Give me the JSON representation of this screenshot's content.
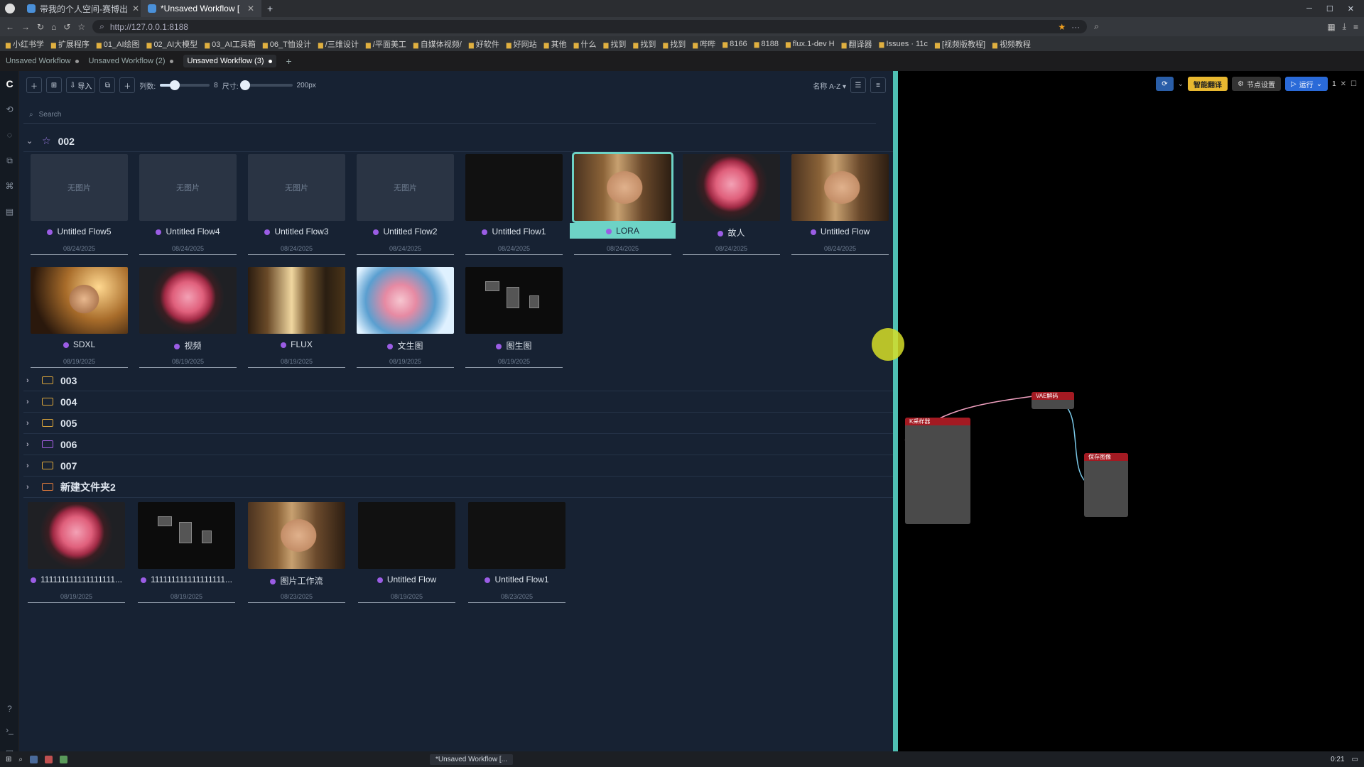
{
  "browser": {
    "tabs": [
      {
        "label": "带我的个人空间-赛博出",
        "active": false
      },
      {
        "label": "*Unsaved Workflow [",
        "active": true
      }
    ],
    "url": "http://127.0.0.1:8188",
    "bookmarks": [
      "小红书学",
      "扩展程序",
      "01_AI绘图",
      "02_AI大模型",
      "03_AI工具箱",
      "06_T恤设计",
      "/三维设计",
      "/平面美工",
      "自媒体视频/",
      "好软件",
      "好网站",
      "其他",
      "什么",
      "找到",
      "找到",
      "找到",
      "哔哔",
      "8166",
      "8188",
      "flux.1-dev H",
      "翻译器",
      "Issues · 11c",
      "[视频版教程]",
      "视频教程"
    ]
  },
  "workflow_tabs": [
    {
      "label": "Unsaved Workflow",
      "active": false
    },
    {
      "label": "Unsaved Workflow (2)",
      "active": false
    },
    {
      "label": "Unsaved Workflow (3)",
      "active": true
    }
  ],
  "toolbar": {
    "import_label": "导入",
    "cols_label": "列数:",
    "cols_value": "8",
    "size_label": "尺寸:",
    "size_value": "200px",
    "sort_label": "名称 A-Z",
    "cols_fraction": 0.3,
    "size_fraction": 0.05
  },
  "search": {
    "placeholder": "Search"
  },
  "groups": {
    "g002": {
      "name": "002",
      "row1": [
        {
          "name": "Untitled Flow5",
          "date": "08/24/2025",
          "thumb": "empty",
          "empty_text": "无图片"
        },
        {
          "name": "Untitled Flow4",
          "date": "08/24/2025",
          "thumb": "empty",
          "empty_text": "无图片"
        },
        {
          "name": "Untitled Flow3",
          "date": "08/24/2025",
          "thumb": "empty",
          "empty_text": "无图片"
        },
        {
          "name": "Untitled Flow2",
          "date": "08/24/2025",
          "thumb": "empty",
          "empty_text": "无图片"
        },
        {
          "name": "Untitled Flow1",
          "date": "08/24/2025",
          "thumb": "collage"
        },
        {
          "name": "LORA",
          "date": "08/24/2025",
          "thumb": "face",
          "selected": true
        },
        {
          "name": "故人",
          "date": "08/24/2025",
          "thumb": "rose"
        },
        {
          "name": "Untitled Flow",
          "date": "08/24/2025",
          "thumb": "face"
        }
      ],
      "row2": [
        {
          "name": "SDXL",
          "date": "08/19/2025",
          "thumb": "portrait"
        },
        {
          "name": "视频",
          "date": "08/19/2025",
          "thumb": "rose"
        },
        {
          "name": "FLUX",
          "date": "08/19/2025",
          "thumb": "forest"
        },
        {
          "name": "文生图",
          "date": "08/19/2025",
          "thumb": "dragon"
        },
        {
          "name": "图生图",
          "date": "08/19/2025",
          "thumb": "nodes"
        }
      ]
    },
    "folders": [
      "003",
      "004",
      "005",
      "006",
      "007",
      "新建文件夹2"
    ],
    "new_folder": [
      {
        "name": "111111111111111111...",
        "date": "08/19/2025",
        "thumb": "rose"
      },
      {
        "name": "111111111111111111...",
        "date": "08/19/2025",
        "thumb": "nodes"
      },
      {
        "name": "图片工作流",
        "date": "08/23/2025",
        "thumb": "face"
      },
      {
        "name": "Untitled Flow",
        "date": "08/19/2025",
        "thumb": "collage"
      },
      {
        "name": "Untitled Flow1",
        "date": "08/23/2025",
        "thumb": "collage"
      }
    ]
  },
  "canvas": {
    "translate_label": "智能翻译",
    "settings_label": "节点设置",
    "run_label": "运行",
    "queue_count": "1",
    "nodes": {
      "ksampler": "K采样器",
      "vae": "VAE解码",
      "save": "保存图像"
    }
  },
  "taskbar": {
    "active_window": "*Unsaved Workflow [...",
    "time": "0:21"
  },
  "colors": {
    "accent": "#4fc0b3",
    "dot": "#9b5de5"
  }
}
